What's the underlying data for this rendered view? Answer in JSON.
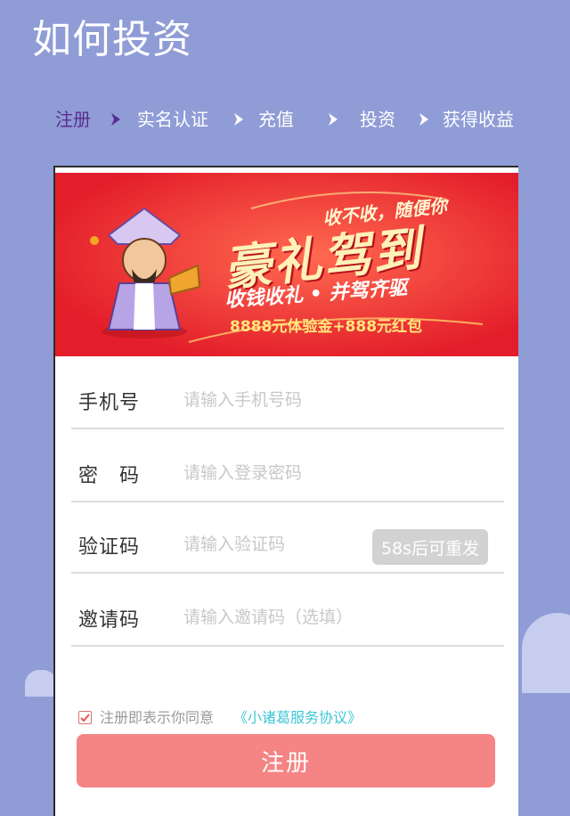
{
  "page": {
    "title": "如何投资"
  },
  "steps": [
    {
      "label": "注册"
    },
    {
      "label": "实名认证"
    },
    {
      "label": "充值"
    },
    {
      "label": "投资"
    },
    {
      "label": "获得收益"
    }
  ],
  "banner": {
    "tagline": "收不收，随便你",
    "headline": "豪礼驾到",
    "subline": "收钱收礼 • 并驾齐驱",
    "offer": "8888元体验金+888元红包"
  },
  "form": {
    "phone": {
      "label": "手机号",
      "placeholder": "请输入手机号码",
      "value": ""
    },
    "password": {
      "label": "密　码",
      "placeholder": "请输入登录密码",
      "value": ""
    },
    "code": {
      "label": "验证码",
      "placeholder": "请输入验证码",
      "value": "",
      "resend_label": "58s后可重发"
    },
    "invite": {
      "label": "邀请码",
      "placeholder": "请输入邀请码（选填）",
      "value": ""
    }
  },
  "agreement": {
    "checked": true,
    "text": "注册即表示你同意",
    "link_text": "《小诸葛服务协议》"
  },
  "submit": {
    "label": "注册"
  },
  "colors": {
    "background": "#8f9cd6",
    "active_step": "#5b2d8e",
    "banner_red": "#e8242f",
    "submit": "#f58484",
    "link": "#3ec6d6"
  }
}
